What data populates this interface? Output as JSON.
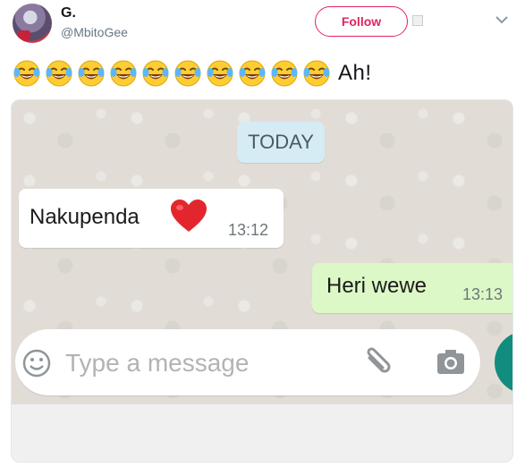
{
  "user": {
    "display_name": "G.",
    "handle": "@MbitoGee"
  },
  "header": {
    "follow_label": "Follow"
  },
  "tweet": {
    "emoji_icons": [
      "face-with-tears-of-joy-icon",
      "face-with-tears-of-joy-icon",
      "face-with-tears-of-joy-icon",
      "face-with-tears-of-joy-icon",
      "face-with-tears-of-joy-icon",
      "face-with-tears-of-joy-icon",
      "face-with-tears-of-joy-icon",
      "face-with-tears-of-joy-icon",
      "face-with-tears-of-joy-icon",
      "face-with-tears-of-joy-icon"
    ],
    "text": "Ah!"
  },
  "chat": {
    "date_label": "TODAY",
    "incoming": {
      "text": "Nakupenda",
      "time": "13:12",
      "emoji": "heart-icon"
    },
    "outgoing": {
      "text": "Heri wewe",
      "time": "13:13"
    },
    "input_placeholder": "Type a message"
  },
  "colors": {
    "follow": "#e0245e",
    "outgoing_bubble": "#dcf8c6",
    "date_chip": "#d6ecf4",
    "send_button": "#128c7e"
  }
}
